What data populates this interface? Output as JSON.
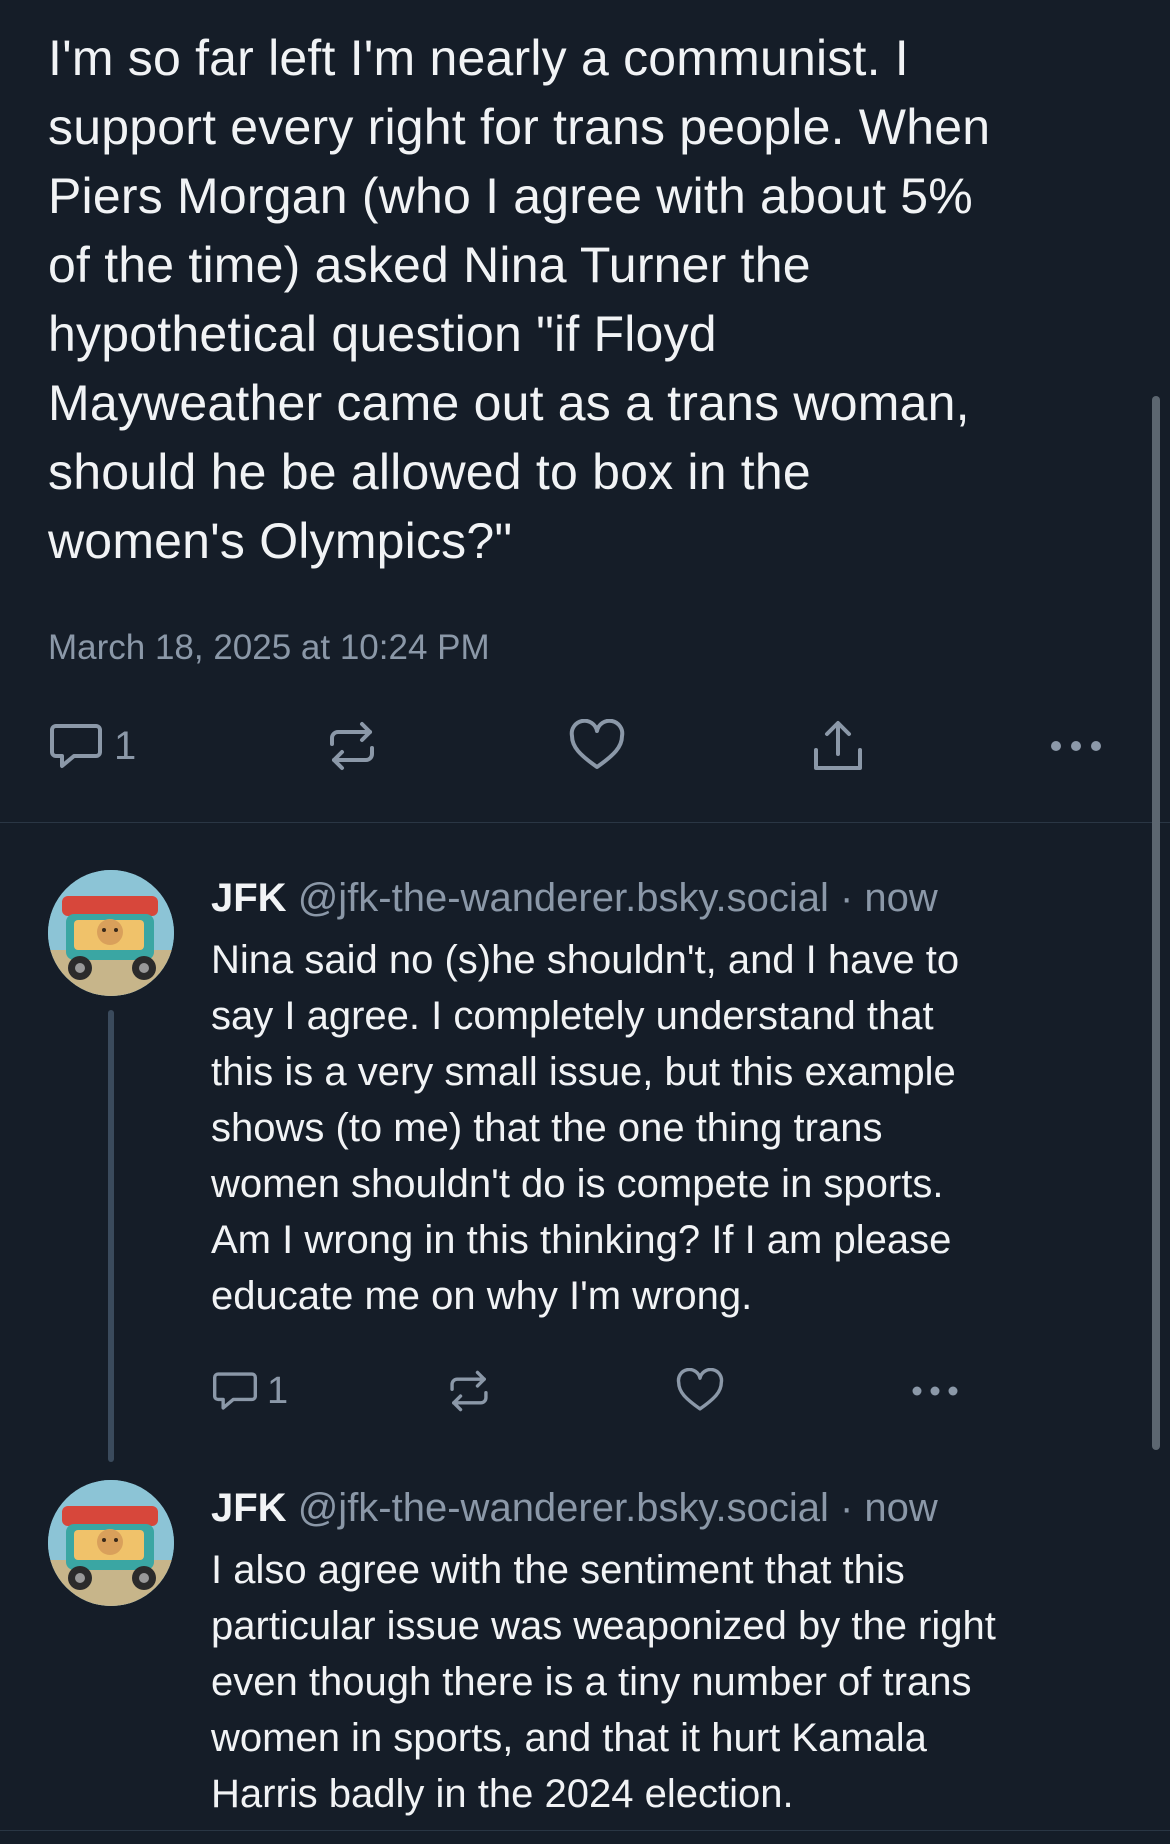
{
  "main_post": {
    "text": "I'm so far left I'm nearly a communist. I\nsupport every right for trans people. When\nPiers Morgan (who I agree with about 5%\nof the time) asked Nina Turner the\nhypothetical question \"if Floyd\nMayweather came out as a trans woman,\nshould he be allowed to box in the\nwomen's Olympics?\"",
    "timestamp": "March 18, 2025 at 10:24 PM",
    "reply_count": "1",
    "icons": [
      "reply-icon",
      "repost-icon",
      "like-icon",
      "share-icon",
      "more-icon"
    ]
  },
  "replies": [
    {
      "name": "JFK",
      "handle": "@jfk-the-wanderer.bsky.social",
      "time": "· now",
      "text": "Nina said no (s)he shouldn't, and I have to\nsay I agree. I completely understand that\nthis is a very small issue, but this example\nshows (to me) that the one thing trans\nwomen shouldn't do is compete in sports.\nAm I wrong in this thinking? If I am please\neducate me on why I'm wrong.",
      "reply_count": "1"
    },
    {
      "name": "JFK",
      "handle": "@jfk-the-wanderer.bsky.social",
      "time": "· now",
      "text": "I also agree with the sentiment that this\nparticular issue was weaponized by the right\neven though there is a tiny number of trans\nwomen in sports, and that it hurt Kamala\nHarris badly in the 2024 election."
    }
  ],
  "colors": {
    "background": "#151d28",
    "text": "#f1f3f5",
    "muted": "#8b98a8",
    "divider": "#2a3644"
  }
}
